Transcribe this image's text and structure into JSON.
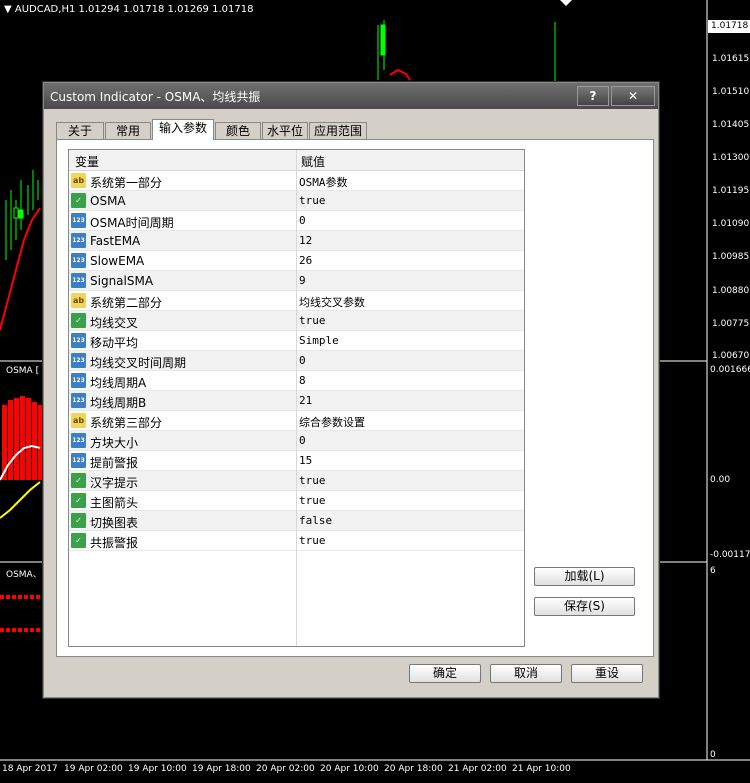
{
  "chart": {
    "symbol_line": "AUDCAD,H1  1.01294 1.01718 1.01269 1.01718",
    "current_price": "1.01718",
    "price_ticks": [
      "1.01615",
      "1.01510",
      "1.01405",
      "1.01300",
      "1.01195",
      "1.01090",
      "1.00985",
      "1.00880",
      "1.00775",
      "1.00670"
    ],
    "osma_label": "OSMA [",
    "osma_ticks": [
      "0.001666",
      "0.00",
      "-0.001171"
    ],
    "sub2_label": "OSMA、",
    "sub2_ticks": [
      "6",
      "0"
    ],
    "time_ticks": [
      "18 Apr 2017",
      "19 Apr 02:00",
      "19 Apr 10:00",
      "19 Apr 18:00",
      "20 Apr 02:00",
      "20 Apr 10:00",
      "20 Apr 18:00",
      "21 Apr 02:00",
      "21 Apr 10:00"
    ]
  },
  "dialog": {
    "title": "Custom Indicator - OSMA、均线共振",
    "help_label": "?",
    "close_label": "✕",
    "tabs": [
      "关于",
      "常用",
      "输入参数",
      "颜色",
      "水平位",
      "应用范围"
    ],
    "active_tab": "输入参数",
    "columns": {
      "variable": "变量",
      "value": "赋值"
    },
    "rows": [
      {
        "type": "ab",
        "name": "系统第一部分",
        "value": "OSMA参数"
      },
      {
        "type": "bool",
        "name": "OSMA",
        "value": "true"
      },
      {
        "type": "num",
        "name": "OSMA时间周期",
        "value": "0"
      },
      {
        "type": "num",
        "name": "FastEMA",
        "value": "12"
      },
      {
        "type": "num",
        "name": "SlowEMA",
        "value": "26"
      },
      {
        "type": "num",
        "name": "SignalSMA",
        "value": "9"
      },
      {
        "type": "ab",
        "name": "系统第二部分",
        "value": "均线交叉参数"
      },
      {
        "type": "bool",
        "name": "均线交叉",
        "value": "true"
      },
      {
        "type": "num",
        "name": "移动平均",
        "value": "Simple"
      },
      {
        "type": "num",
        "name": "均线交叉时间周期",
        "value": "0"
      },
      {
        "type": "num",
        "name": "均线周期A",
        "value": "8"
      },
      {
        "type": "num",
        "name": "均线周期B",
        "value": "21"
      },
      {
        "type": "ab",
        "name": "系统第三部分",
        "value": "综合参数设置"
      },
      {
        "type": "num",
        "name": "方块大小",
        "value": "0"
      },
      {
        "type": "num",
        "name": "提前警报",
        "value": "15"
      },
      {
        "type": "bool",
        "name": "汉字提示",
        "value": "true"
      },
      {
        "type": "bool",
        "name": "主图箭头",
        "value": "true"
      },
      {
        "type": "bool",
        "name": "切换图表",
        "value": "false"
      },
      {
        "type": "bool",
        "name": "共振警报",
        "value": "true"
      }
    ],
    "load_button": "加载(L)",
    "save_button": "保存(S)",
    "ok_button": "确定",
    "cancel_button": "取消",
    "reset_button": "重设"
  },
  "colors": {
    "bull": "#00ff00",
    "bear": "#ff0000",
    "signal": "#ffff00",
    "dialog_bg": "#d4d0c8"
  }
}
